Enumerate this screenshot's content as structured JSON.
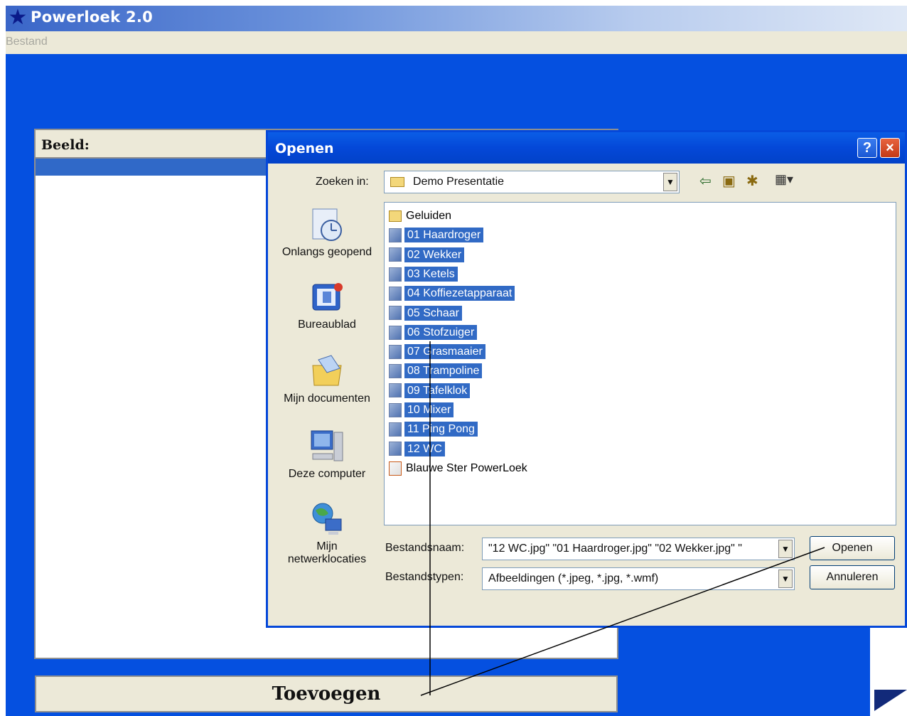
{
  "app": {
    "title": "Powerloek 2.0",
    "menu": [
      "Bestand"
    ]
  },
  "main": {
    "beeld_label": "Beeld:",
    "add_button": "Toevoegen"
  },
  "dialog": {
    "title": "Openen",
    "help": "?",
    "close": "×",
    "look_in_label": "Zoeken in:",
    "look_in_value": "Demo Presentatie",
    "places": [
      {
        "label": "Onlangs geopend",
        "icon": "recent-icon"
      },
      {
        "label": "Bureaublad",
        "icon": "desktop-icon"
      },
      {
        "label": "Mijn documenten",
        "icon": "documents-icon"
      },
      {
        "label": "Deze computer",
        "icon": "computer-icon"
      },
      {
        "label": "Mijn netwerklocaties",
        "icon": "network-icon"
      }
    ],
    "files": [
      {
        "name": "Geluiden",
        "type": "folder",
        "selected": false
      },
      {
        "name": "01 Haardroger",
        "type": "image",
        "selected": true
      },
      {
        "name": "02 Wekker",
        "type": "image",
        "selected": true
      },
      {
        "name": "03 Ketels",
        "type": "image",
        "selected": true
      },
      {
        "name": "04 Koffiezetapparaat",
        "type": "image",
        "selected": true
      },
      {
        "name": "05 Schaar",
        "type": "image",
        "selected": true
      },
      {
        "name": "06 Stofzuiger",
        "type": "image",
        "selected": true
      },
      {
        "name": "07 Grasmaaier",
        "type": "image",
        "selected": true
      },
      {
        "name": "08 Trampoline",
        "type": "image",
        "selected": true
      },
      {
        "name": "09 Tafelklok",
        "type": "image",
        "selected": true
      },
      {
        "name": "10 Mixer",
        "type": "image",
        "selected": true
      },
      {
        "name": "11 Ping Pong",
        "type": "image",
        "selected": true
      },
      {
        "name": "12 WC",
        "type": "image",
        "selected": true
      },
      {
        "name": "Blauwe Ster PowerLoek",
        "type": "app",
        "selected": false
      }
    ],
    "filename_label": "Bestandsnaam:",
    "filename_value": "\"12 WC.jpg\" \"01 Haardroger.jpg\" \"02 Wekker.jpg\" \"",
    "filetype_label": "Bestandstypen:",
    "filetype_value": "Afbeeldingen (*.jpeg, *.jpg, *.wmf)",
    "open_button": "Openen",
    "cancel_button": "Annuleren"
  }
}
